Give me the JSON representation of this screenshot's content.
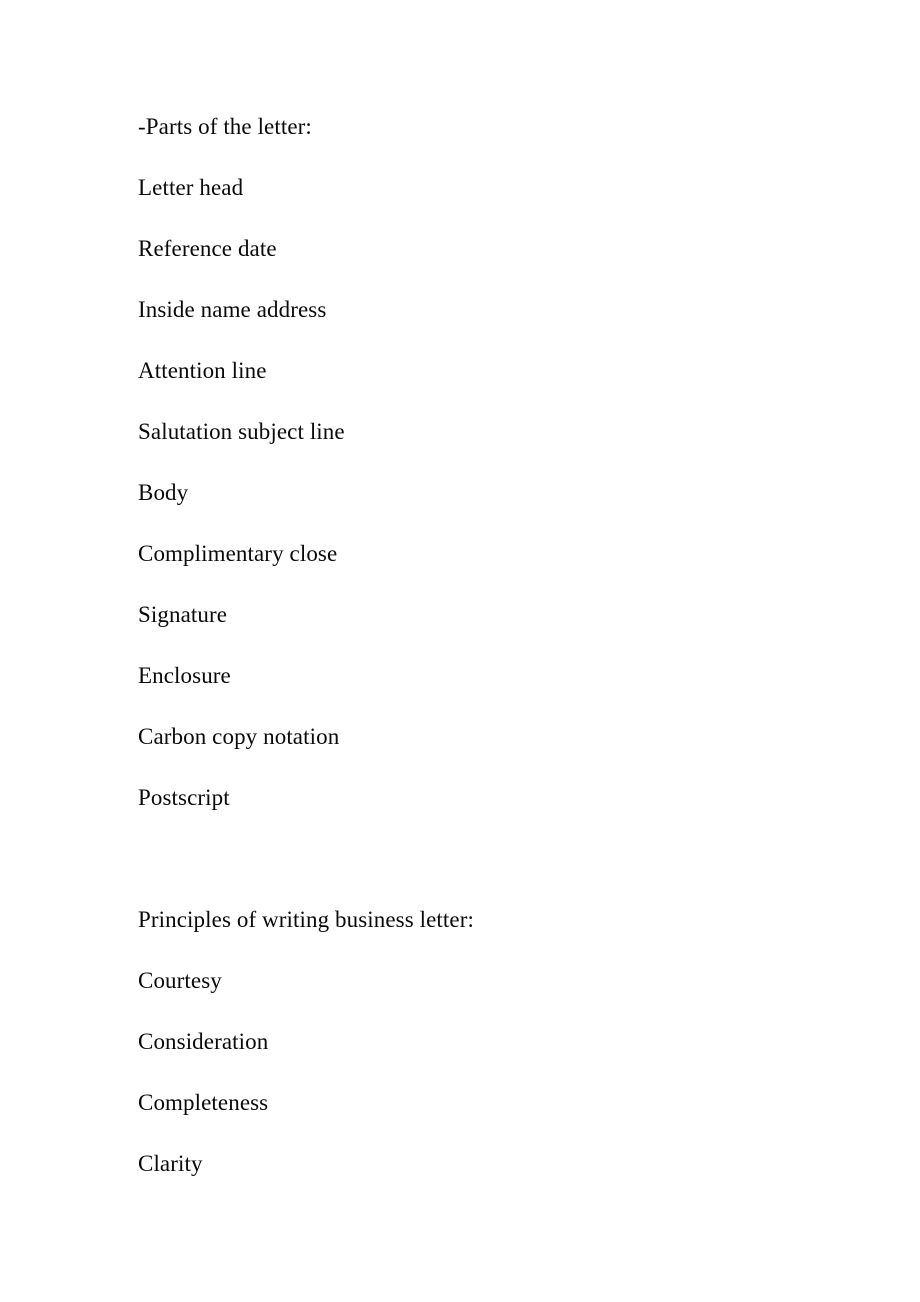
{
  "document": {
    "background_color": "#ffffff",
    "text_color": "#0a0a0a",
    "sections": [
      {
        "id": "parts-of-the-letter",
        "heading": "-Parts of the letter:",
        "items": [
          "Letter head",
          "Reference date",
          "Inside name address",
          "Attention line",
          "Salutation subject line",
          "Body",
          "Complimentary close",
          "Signature",
          "Enclosure",
          "Carbon copy notation",
          "Postscript"
        ]
      },
      {
        "id": "principles-of-writing-business-letter",
        "heading": "Principles of writing business letter:",
        "items": [
          "Courtesy",
          "Consideration",
          "Completeness",
          "Clarity"
        ]
      }
    ],
    "lines": [
      "-Parts of the letter:",
      "Letter head",
      "Reference date",
      "Inside name address",
      "Attention line",
      "Salutation subject line",
      "Body",
      "Complimentary close",
      "Signature",
      "Enclosure",
      "Carbon copy notation",
      "Postscript",
      "",
      "Principles of writing business letter:",
      "Courtesy",
      "Consideration",
      "Completeness",
      "Clarity"
    ]
  }
}
